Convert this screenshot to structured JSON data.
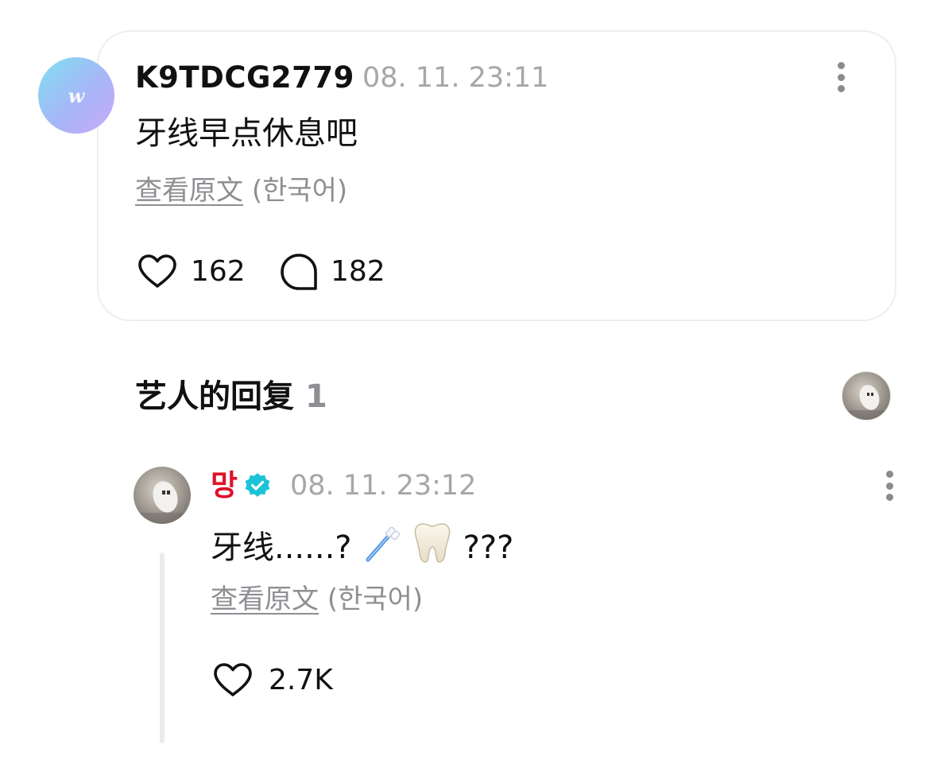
{
  "post": {
    "avatar_letter": "w",
    "username": "K9TDCG2779",
    "timestamp": "08. 11. 23:11",
    "text": "牙线早点休息吧",
    "translate_link": "查看原文",
    "translate_lang": "(한국어)",
    "likes": "162",
    "comments": "182",
    "icons": {
      "avatar": "weverse-w-avatar",
      "more": "more-vertical-icon",
      "like": "heart-outline-icon",
      "comment": "chat-bubble-outline-icon"
    }
  },
  "artist_replies": {
    "title": "艺人的回复",
    "count": "1"
  },
  "reply": {
    "username": "망",
    "verified_icon": "verified-badge-icon",
    "timestamp": "08. 11. 23:12",
    "text_prefix": "牙线......? ",
    "emojis": [
      "toothbrush",
      "tooth"
    ],
    "text_suffix": "???",
    "translate_link": "查看原文",
    "translate_lang": "(한국어)",
    "likes": "2.7K"
  },
  "colors": {
    "artist_name": "#e0112a",
    "verified_badge": "#1cc3d8",
    "muted_text": "#8e8e93",
    "timestamp": "#a6a6ab",
    "card_border": "#eeeef1"
  }
}
